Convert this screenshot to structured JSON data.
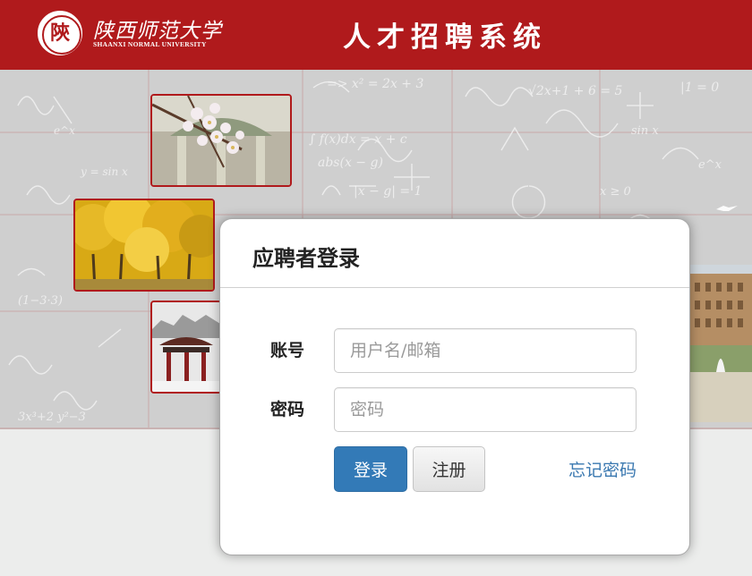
{
  "header": {
    "logo_seal_glyph": "陝",
    "logo_name_cn": "陕西师范大学",
    "logo_name_en": "SHAANXI NORMAL UNIVERSITY",
    "system_title": "人才招聘系统",
    "brand_color": "#b01a1c"
  },
  "login": {
    "title": "应聘者登录",
    "account_label": "账号",
    "account_placeholder": "用户名/邮箱",
    "account_value": "",
    "password_label": "密码",
    "password_placeholder": "密码",
    "password_value": "",
    "login_button": "登录",
    "register_button": "注册",
    "forgot_link": "忘记密码",
    "primary_color": "#337ab7"
  }
}
